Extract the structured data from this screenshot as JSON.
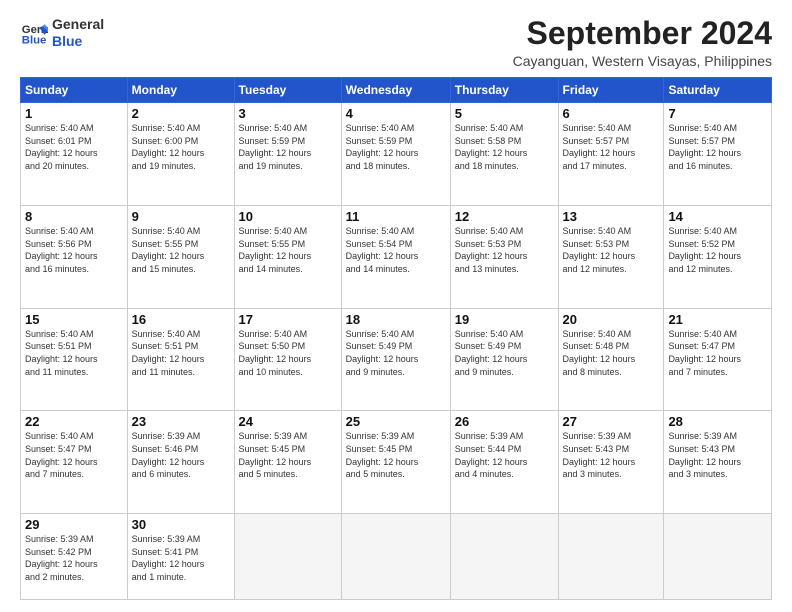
{
  "header": {
    "logo_line1": "General",
    "logo_line2": "Blue",
    "month_title": "September 2024",
    "location": "Cayanguan, Western Visayas, Philippines"
  },
  "weekdays": [
    "Sunday",
    "Monday",
    "Tuesday",
    "Wednesday",
    "Thursday",
    "Friday",
    "Saturday"
  ],
  "weeks": [
    [
      {
        "day": "1",
        "info": "Sunrise: 5:40 AM\nSunset: 6:01 PM\nDaylight: 12 hours\nand 20 minutes."
      },
      {
        "day": "2",
        "info": "Sunrise: 5:40 AM\nSunset: 6:00 PM\nDaylight: 12 hours\nand 19 minutes."
      },
      {
        "day": "3",
        "info": "Sunrise: 5:40 AM\nSunset: 5:59 PM\nDaylight: 12 hours\nand 19 minutes."
      },
      {
        "day": "4",
        "info": "Sunrise: 5:40 AM\nSunset: 5:59 PM\nDaylight: 12 hours\nand 18 minutes."
      },
      {
        "day": "5",
        "info": "Sunrise: 5:40 AM\nSunset: 5:58 PM\nDaylight: 12 hours\nand 18 minutes."
      },
      {
        "day": "6",
        "info": "Sunrise: 5:40 AM\nSunset: 5:57 PM\nDaylight: 12 hours\nand 17 minutes."
      },
      {
        "day": "7",
        "info": "Sunrise: 5:40 AM\nSunset: 5:57 PM\nDaylight: 12 hours\nand 16 minutes."
      }
    ],
    [
      {
        "day": "8",
        "info": "Sunrise: 5:40 AM\nSunset: 5:56 PM\nDaylight: 12 hours\nand 16 minutes."
      },
      {
        "day": "9",
        "info": "Sunrise: 5:40 AM\nSunset: 5:55 PM\nDaylight: 12 hours\nand 15 minutes."
      },
      {
        "day": "10",
        "info": "Sunrise: 5:40 AM\nSunset: 5:55 PM\nDaylight: 12 hours\nand 14 minutes."
      },
      {
        "day": "11",
        "info": "Sunrise: 5:40 AM\nSunset: 5:54 PM\nDaylight: 12 hours\nand 14 minutes."
      },
      {
        "day": "12",
        "info": "Sunrise: 5:40 AM\nSunset: 5:53 PM\nDaylight: 12 hours\nand 13 minutes."
      },
      {
        "day": "13",
        "info": "Sunrise: 5:40 AM\nSunset: 5:53 PM\nDaylight: 12 hours\nand 12 minutes."
      },
      {
        "day": "14",
        "info": "Sunrise: 5:40 AM\nSunset: 5:52 PM\nDaylight: 12 hours\nand 12 minutes."
      }
    ],
    [
      {
        "day": "15",
        "info": "Sunrise: 5:40 AM\nSunset: 5:51 PM\nDaylight: 12 hours\nand 11 minutes."
      },
      {
        "day": "16",
        "info": "Sunrise: 5:40 AM\nSunset: 5:51 PM\nDaylight: 12 hours\nand 11 minutes."
      },
      {
        "day": "17",
        "info": "Sunrise: 5:40 AM\nSunset: 5:50 PM\nDaylight: 12 hours\nand 10 minutes."
      },
      {
        "day": "18",
        "info": "Sunrise: 5:40 AM\nSunset: 5:49 PM\nDaylight: 12 hours\nand 9 minutes."
      },
      {
        "day": "19",
        "info": "Sunrise: 5:40 AM\nSunset: 5:49 PM\nDaylight: 12 hours\nand 9 minutes."
      },
      {
        "day": "20",
        "info": "Sunrise: 5:40 AM\nSunset: 5:48 PM\nDaylight: 12 hours\nand 8 minutes."
      },
      {
        "day": "21",
        "info": "Sunrise: 5:40 AM\nSunset: 5:47 PM\nDaylight: 12 hours\nand 7 minutes."
      }
    ],
    [
      {
        "day": "22",
        "info": "Sunrise: 5:40 AM\nSunset: 5:47 PM\nDaylight: 12 hours\nand 7 minutes."
      },
      {
        "day": "23",
        "info": "Sunrise: 5:39 AM\nSunset: 5:46 PM\nDaylight: 12 hours\nand 6 minutes."
      },
      {
        "day": "24",
        "info": "Sunrise: 5:39 AM\nSunset: 5:45 PM\nDaylight: 12 hours\nand 5 minutes."
      },
      {
        "day": "25",
        "info": "Sunrise: 5:39 AM\nSunset: 5:45 PM\nDaylight: 12 hours\nand 5 minutes."
      },
      {
        "day": "26",
        "info": "Sunrise: 5:39 AM\nSunset: 5:44 PM\nDaylight: 12 hours\nand 4 minutes."
      },
      {
        "day": "27",
        "info": "Sunrise: 5:39 AM\nSunset: 5:43 PM\nDaylight: 12 hours\nand 3 minutes."
      },
      {
        "day": "28",
        "info": "Sunrise: 5:39 AM\nSunset: 5:43 PM\nDaylight: 12 hours\nand 3 minutes."
      }
    ],
    [
      {
        "day": "29",
        "info": "Sunrise: 5:39 AM\nSunset: 5:42 PM\nDaylight: 12 hours\nand 2 minutes."
      },
      {
        "day": "30",
        "info": "Sunrise: 5:39 AM\nSunset: 5:41 PM\nDaylight: 12 hours\nand 1 minute."
      },
      {
        "day": "",
        "info": ""
      },
      {
        "day": "",
        "info": ""
      },
      {
        "day": "",
        "info": ""
      },
      {
        "day": "",
        "info": ""
      },
      {
        "day": "",
        "info": ""
      }
    ]
  ]
}
